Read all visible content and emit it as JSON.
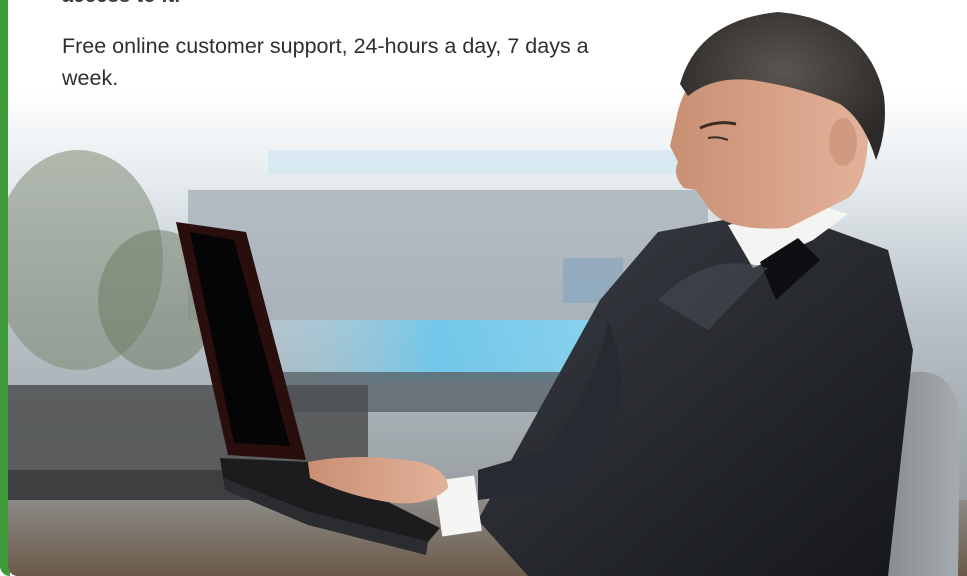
{
  "panel": {
    "truncated_line": "access to it.",
    "support_text": "Free online customer support, 24-hours a day, 7 days a week."
  },
  "image": {
    "subject": "businessman-with-laptop",
    "accent_color": "#3f9a3a",
    "counter_glow": "#7fd3f2"
  }
}
